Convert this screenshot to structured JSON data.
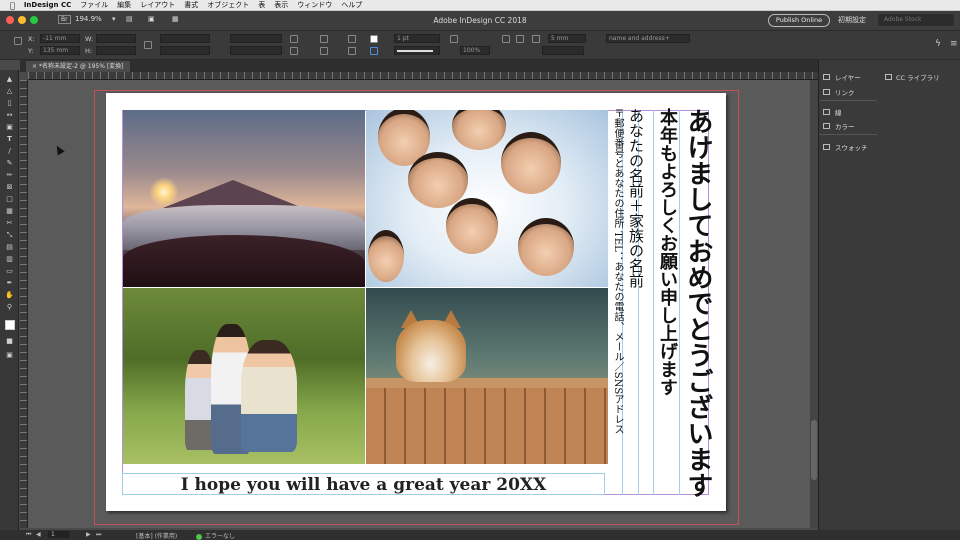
{
  "menubar": {
    "app": "InDesign CC",
    "items": [
      "ファイル",
      "編集",
      "レイアウト",
      "書式",
      "オブジェクト",
      "表",
      "表示",
      "ウィンドウ",
      "ヘルプ"
    ]
  },
  "titlebar": {
    "title": "Adobe InDesign CC 2018",
    "br_label": "Br",
    "zoom": "194.9%",
    "publish_label": "Publish Online",
    "workspace": "初期設定",
    "search_placeholder": "Adobe Stock"
  },
  "controlbar": {
    "x_label": "X:",
    "y_label": "Y:",
    "w_label": "W:",
    "h_label": "H:",
    "x_value": "-11 mm",
    "y_value": "135 mm",
    "stroke_weight": "1 pt",
    "corner_size": "5 mm",
    "opacity": "100%",
    "object_style_placeholder": "name and address+"
  },
  "document_tab": {
    "label": "*名称未設定-2 @ 195% [変換]"
  },
  "card": {
    "greeting": "あけましておめでとうございます",
    "subtitle": "本年もよろしくお願い申し上げます",
    "names": "あなたの名前＋家族の名前",
    "address": "〒郵便番号とあなたの住所 TEL：あなたの電話、メール／SNSアドレス",
    "caption": "I hope you will have a great year 20XX"
  },
  "panels": {
    "items": [
      "レイヤー",
      "リンク",
      "線",
      "カラー",
      "スウォッチ"
    ],
    "cc_libraries": "CC ライブラリ"
  },
  "statusbar": {
    "page_number": "1",
    "master": "[基本] (作業用)",
    "preflight": "エラーなし"
  },
  "colors": {
    "bleed_guide": "#c0505a",
    "margin_guide": "#b68fd8",
    "column_guide": "#9ed0ee",
    "preflight_ok": "#4fc34a"
  }
}
